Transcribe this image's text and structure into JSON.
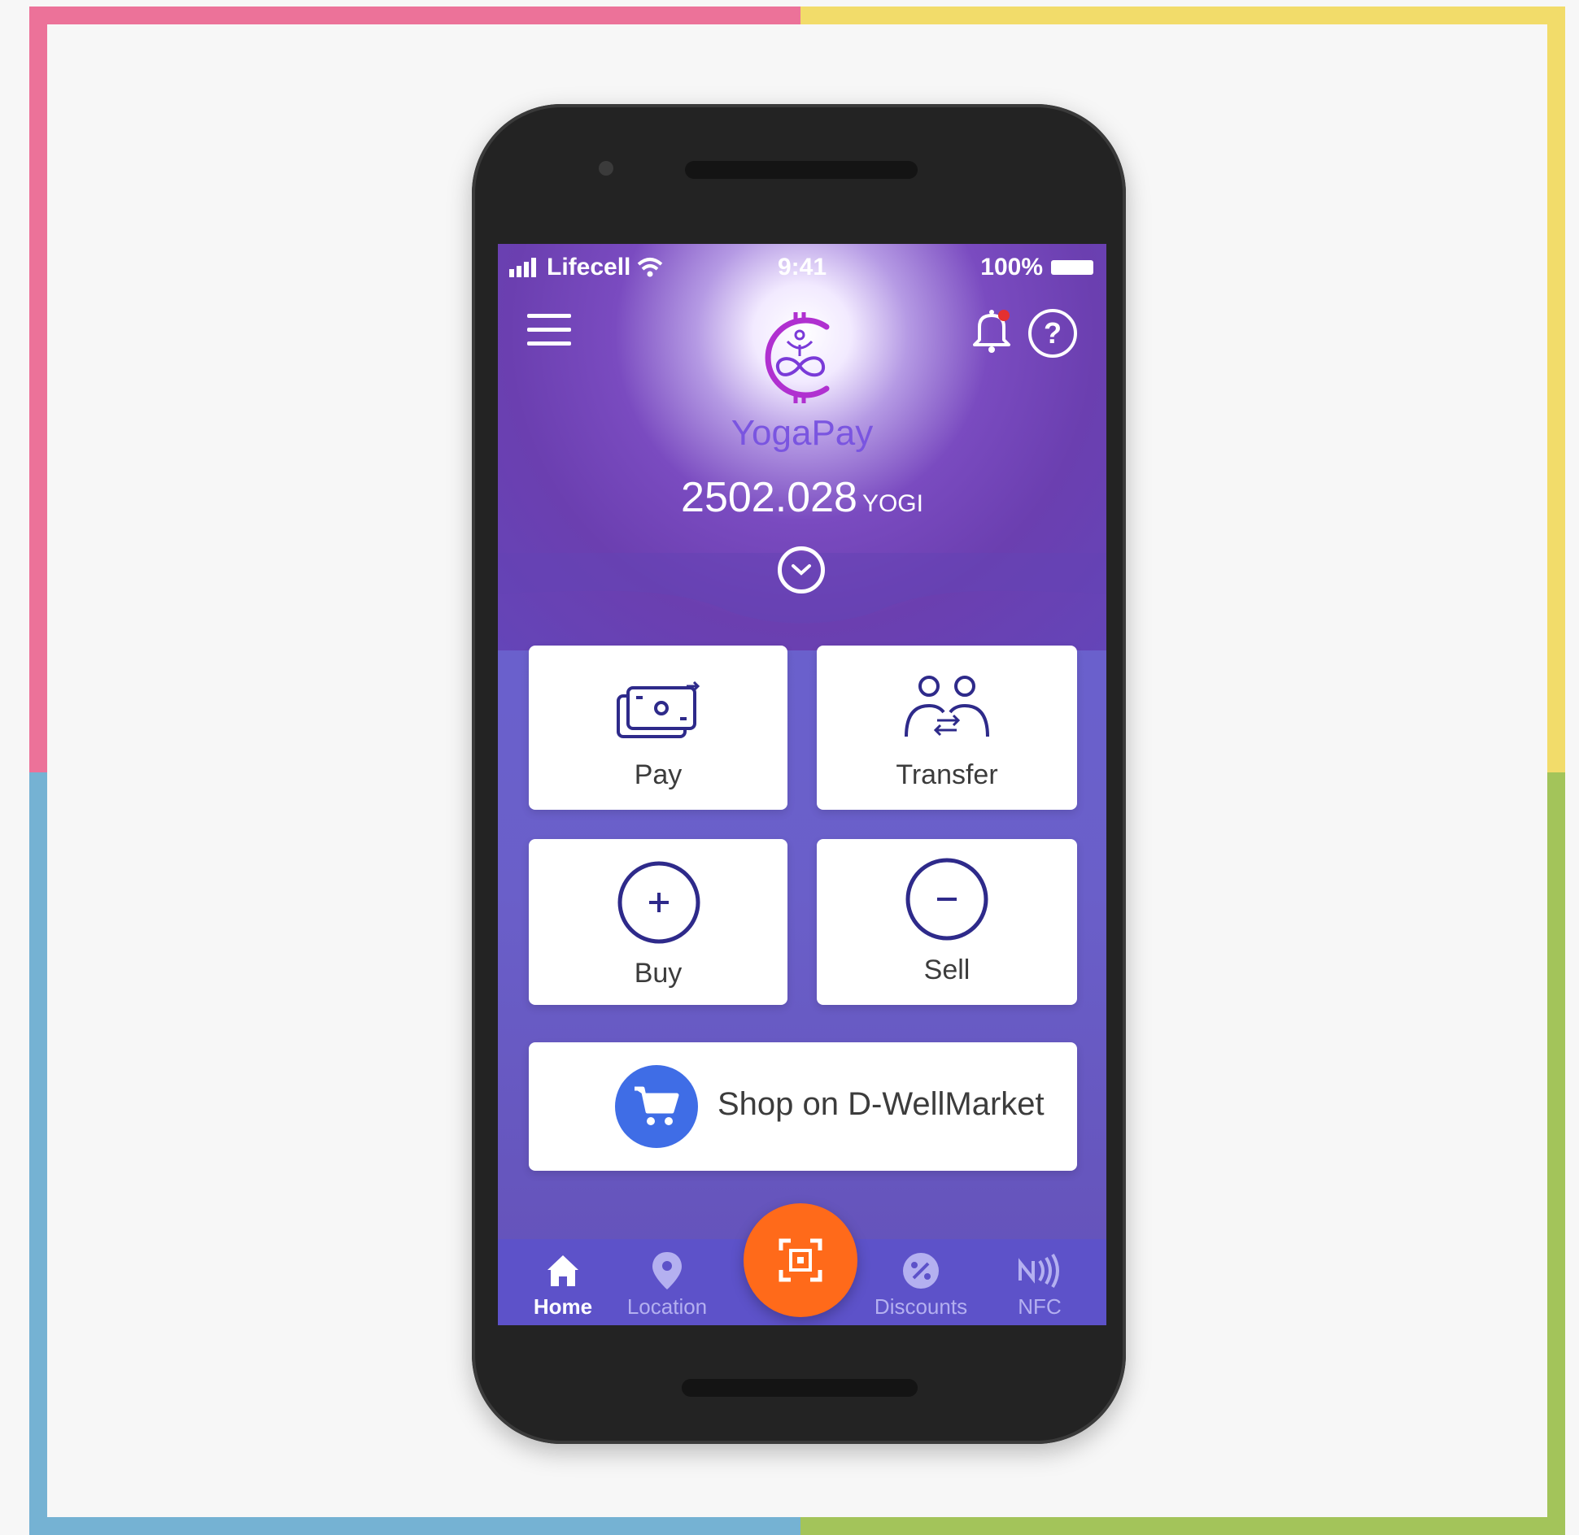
{
  "status_bar": {
    "carrier": "Lifecell",
    "time": "9:41",
    "battery": "100%"
  },
  "header": {
    "brand": "YogaPay"
  },
  "balance": {
    "amount": "2502.028",
    "unit": "YOGI"
  },
  "actions": [
    {
      "label": "Pay",
      "icon": "pay-icon"
    },
    {
      "label": "Transfer",
      "icon": "transfer-icon"
    },
    {
      "label": "Buy",
      "icon": "plus-circle-icon"
    },
    {
      "label": "Sell",
      "icon": "minus-circle-icon"
    }
  ],
  "shop": {
    "label": "Shop on D-WellMarket",
    "icon": "cart-icon"
  },
  "nav": [
    {
      "label": "Home",
      "icon": "home-icon",
      "active": true
    },
    {
      "label": "Location",
      "icon": "location-pin-icon"
    },
    {
      "label": "Discounts",
      "icon": "percent-icon"
    },
    {
      "label": "NFC",
      "icon": "nfc-icon"
    }
  ],
  "colors": {
    "accent": "#6b63d2",
    "scan_button": "#ff6a1a",
    "shop_icon_bg": "#3f6de6",
    "notification_dot": "#e53030"
  }
}
